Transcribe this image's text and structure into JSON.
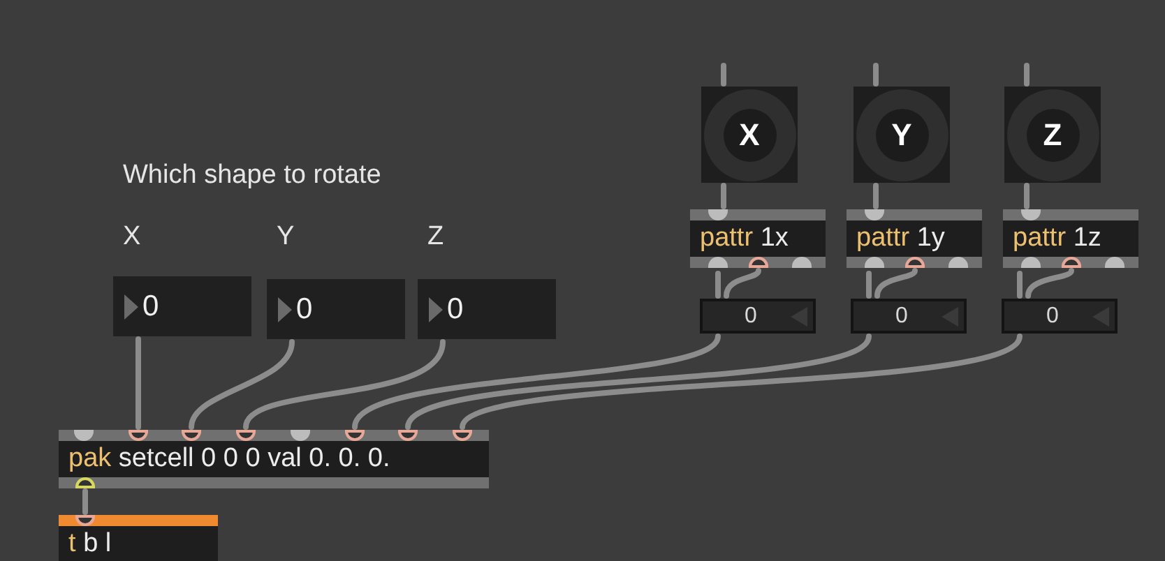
{
  "comments": [
    {
      "text": "Which shape to rotate"
    },
    {
      "text": "X"
    },
    {
      "text": "Y"
    },
    {
      "text": "Z"
    }
  ],
  "number_boxes": [
    {
      "value": "0"
    },
    {
      "value": "0"
    },
    {
      "value": "0"
    }
  ],
  "buttons": [
    {
      "label": "X"
    },
    {
      "label": "Y"
    },
    {
      "label": "Z"
    }
  ],
  "objects": [
    {
      "class": "pattr",
      "args": "1x",
      "selected": false
    },
    {
      "class": "pattr",
      "args": "1y",
      "selected": false
    },
    {
      "class": "pattr",
      "args": "1z",
      "selected": false
    },
    {
      "class": "pak",
      "args": "setcell 0 0 0 val 0. 0. 0.",
      "selected": false
    },
    {
      "class": "t",
      "args": "b l",
      "selected": true
    }
  ],
  "float_boxes": [
    {
      "value": "0"
    },
    {
      "value": "0"
    },
    {
      "value": "0"
    }
  ]
}
